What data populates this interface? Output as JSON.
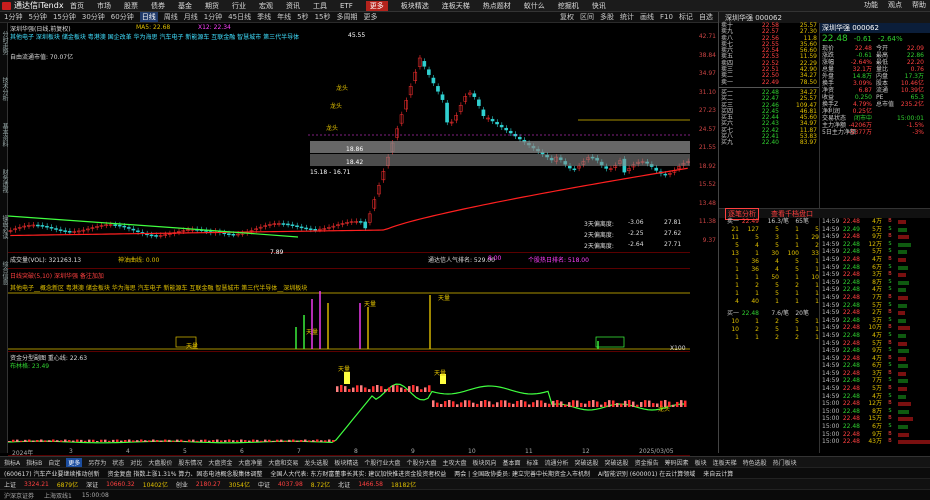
{
  "app": {
    "title": "通达信iTendx"
  },
  "menu": [
    "首页",
    "市场",
    "股票",
    "债券",
    "基金",
    "期货",
    "行业",
    "宏观",
    "资讯",
    "工具",
    "ETF",
    "更多"
  ],
  "menu_right": [
    "板块精选",
    "连板天梯",
    "热点题材",
    "蚁什么",
    "挖掘机",
    "快讯"
  ],
  "window_controls": [
    "功能",
    "观点",
    "帮助"
  ],
  "toolbar": [
    "1分钟",
    "5分钟",
    "15分钟",
    "30分钟",
    "60分钟",
    "日线",
    "周线",
    "月线",
    "1分钟",
    "45日线",
    "季线",
    "年线",
    "5秒",
    "15秒",
    "多周期",
    "更多"
  ],
  "toolbar_right": [
    "复权",
    "区间",
    "多股",
    "统计",
    "画线",
    "F10",
    "标记",
    "自选"
  ],
  "left_tabs": [
    "分时走势",
    "技术分析",
    "基本资料",
    "财务透视",
    "操盘必读",
    "综合信息"
  ],
  "main": {
    "title": "深圳华强(日线,前复权)",
    "ma": "MA5: 22.68",
    "info2": "X12: 22.34",
    "sectors": "其他电子 深圳板块 储金板块 粤港澳 国企改革 华为海思 汽车电子 新能源车 互联金融 智慧城市 第三代半导体",
    "float_cap": "自由流通市值: 70.07亿",
    "price_labels": {
      "high": "45.55",
      "low": "7.89",
      "p1": "18.86",
      "p2": "18.42",
      "p3": "15.18 - 16.71"
    },
    "annotations": [
      "龙头",
      "龙头",
      "龙头",
      "龙头",
      "龙头"
    ],
    "stats": [
      {
        "label": "3天偏离度:",
        "v1": "-3.06",
        "v2": "27.81"
      },
      {
        "label": "2天偏离度:",
        "v1": "-2.25",
        "v2": "27.62"
      },
      {
        "label": "2天偏离度:",
        "v1": "-2.64",
        "v2": "27.71"
      }
    ],
    "y_axis": [
      "42.71",
      "38.84",
      "34.97",
      "31.10",
      "27.23",
      "24.57",
      "21.55",
      "18.92",
      "15.52",
      "13.48",
      "11.38",
      "9.37"
    ]
  },
  "vol": {
    "title": "成交量(VOL): 321263.13",
    "ma": "神油曲线: 0.00",
    "text3": "通达信人气排名: 529.00",
    "text4": "8.00",
    "text5": "个股热日排名: 518.00"
  },
  "sig": {
    "title": "日线突破(5,10)  深圳华强 备注加加",
    "line2": "其他电子__概念新区 粤港澳 储金板块 华为海思 汽车电子 新能源车 互联金融 智慧城市 第三代半导体__深圳板块",
    "tags": [
      "天量",
      "天量",
      "天量",
      "天量",
      "天量",
      "天量"
    ],
    "axis": [
      "X100"
    ]
  },
  "ind": {
    "title": "资金分型副图  重心线: 22.63",
    "sub": "布林格: 23.49",
    "labels": [
      "天量",
      "天量",
      "龙头"
    ],
    "dates": [
      "2024年",
      "3",
      "4",
      "5",
      "6",
      "7",
      "8",
      "9",
      "10",
      "11",
      "12",
      "2025/03/05"
    ]
  },
  "right": {
    "header": "深圳华强 000062",
    "price": "22.48",
    "chg": "-0.61",
    "pct": "-2.64%",
    "sell": [
      {
        "label": "卖十",
        "price": "22.58",
        "vol": "25.57"
      },
      {
        "label": "卖九",
        "price": "22.57",
        "vol": "27.30"
      },
      {
        "label": "卖八",
        "price": "22.56",
        "vol": "11.8"
      },
      {
        "label": "卖七",
        "price": "22.55",
        "vol": "35.60"
      },
      {
        "label": "卖六",
        "price": "22.54",
        "vol": "56.60"
      },
      {
        "label": "卖五",
        "price": "22.53",
        "vol": "11.59"
      },
      {
        "label": "卖四",
        "price": "22.52",
        "vol": "22.29"
      },
      {
        "label": "卖三",
        "price": "22.51",
        "vol": "42.90"
      },
      {
        "label": "卖二",
        "price": "22.50",
        "vol": "34.27"
      },
      {
        "label": "卖一",
        "price": "22.49",
        "vol": "78.50"
      }
    ],
    "buy": [
      {
        "label": "买一",
        "price": "22.48",
        "vol": "34.27"
      },
      {
        "label": "买二",
        "price": "22.47",
        "vol": "25.57"
      },
      {
        "label": "买三",
        "price": "22.46",
        "vol": "109.47"
      },
      {
        "label": "买四",
        "price": "22.45",
        "vol": "46.81"
      },
      {
        "label": "买五",
        "price": "22.44",
        "vol": "45.60"
      },
      {
        "label": "买六",
        "price": "22.43",
        "vol": "34.97"
      },
      {
        "label": "买七",
        "price": "22.42",
        "vol": "11.87"
      },
      {
        "label": "买八",
        "price": "22.41",
        "vol": "53.83"
      },
      {
        "label": "买九",
        "price": "22.40",
        "vol": "83.97"
      }
    ],
    "info": [
      {
        "k": "现价",
        "v": "22.48",
        "k2": "今开",
        "v2": "22.09"
      },
      {
        "k": "涨跌",
        "v": "-0.61",
        "k2": "最高",
        "v2": "22.86"
      },
      {
        "k": "涨幅",
        "v": "-2.64%",
        "k2": "最低",
        "v2": "22.20"
      },
      {
        "k": "总量",
        "v": "32.1万",
        "k2": "量比",
        "v2": "0.76"
      },
      {
        "k": "外盘",
        "v": "14.8万",
        "k2": "内盘",
        "v2": "17.3万"
      },
      {
        "k": "换手",
        "v": "3.09%",
        "k2": "股本",
        "v2": "10.46亿"
      },
      {
        "k": "净资",
        "v": "6.87",
        "k2": "流通",
        "v2": "10.39亿"
      },
      {
        "k": "收益",
        "v": "0.250",
        "k2": "PE",
        "v2": "65.3"
      },
      {
        "k": "换手Z",
        "v": "4.79%",
        "k2": "总市值",
        "v2": "235.2亿"
      },
      {
        "k": "净利润",
        "v": "0.25亿",
        "k2": "",
        "v2": ""
      },
      {
        "k": "交易状态",
        "v": "闭市中",
        "k2": "",
        "v2": "15:00:01"
      },
      {
        "k": "主力净额",
        "v": "-4206万",
        "k2": "",
        "v2": "-1.5%"
      },
      {
        "k": "5日主力净额",
        "v": "-5377万",
        "k2": "",
        "v2": "-3%"
      }
    ],
    "tabs": [
      "逐笔分析",
      "查看千档盘口"
    ],
    "depth_header": {
      "a": "卖一",
      "b": "22.49",
      "c": "16.3/笔",
      "d": "65笔"
    },
    "depth": [
      [
        "21",
        "127",
        "5",
        "1",
        "5"
      ],
      [
        "11",
        "5",
        "3",
        "1",
        "29"
      ],
      [
        "5",
        "4",
        "5",
        "1",
        "2"
      ],
      [
        "13",
        "1",
        "30",
        "100",
        "33"
      ],
      [
        "1",
        "36",
        "4",
        "5",
        "1"
      ],
      [
        "1",
        "36",
        "4",
        "5",
        "1"
      ],
      [
        "1",
        "1",
        "50",
        "1",
        "10"
      ],
      [
        "1",
        "2",
        "5",
        "2",
        "1"
      ],
      [
        "1",
        "1",
        "5",
        "1",
        "1"
      ],
      [
        "4",
        "40",
        "1",
        "1",
        "1"
      ]
    ],
    "depth_footer": {
      "a": "买一",
      "b": "22.48",
      "c": "7.6/笔",
      "d": "20笔"
    },
    "depth2": [
      [
        "10",
        "1",
        "2",
        "5",
        "1"
      ],
      [
        "10",
        "2",
        "5",
        "1",
        "1"
      ],
      [
        "1",
        "1",
        "2",
        "2",
        "1"
      ]
    ],
    "ticks": [
      {
        "t": "14:59",
        "p": "22.48",
        "v": "4万",
        "b": "B"
      },
      {
        "t": "14:59",
        "p": "22.49",
        "v": "5万",
        "b": "S"
      },
      {
        "t": "14:59",
        "p": "22.48",
        "v": "9万",
        "b": "B"
      },
      {
        "t": "14:59",
        "p": "22.48",
        "v": "12万",
        "b": "S"
      },
      {
        "t": "14:59",
        "p": "22.48",
        "v": "5万",
        "b": "S"
      },
      {
        "t": "14:59",
        "p": "22.48",
        "v": "4万",
        "b": "B"
      },
      {
        "t": "14:59",
        "p": "22.48",
        "v": "6万",
        "b": "S"
      },
      {
        "t": "14:59",
        "p": "22.48",
        "v": "3万",
        "b": "B"
      },
      {
        "t": "14:59",
        "p": "22.48",
        "v": "8万",
        "b": "S"
      },
      {
        "t": "14:59",
        "p": "22.48",
        "v": "4万",
        "b": "S"
      },
      {
        "t": "14:59",
        "p": "22.48",
        "v": "7万",
        "b": "B"
      },
      {
        "t": "14:59",
        "p": "22.48",
        "v": "5万",
        "b": "S"
      },
      {
        "t": "14:59",
        "p": "22.48",
        "v": "2万",
        "b": "B"
      },
      {
        "t": "14:59",
        "p": "22.48",
        "v": "3万",
        "b": "S"
      },
      {
        "t": "14:59",
        "p": "22.48",
        "v": "10万",
        "b": "B"
      },
      {
        "t": "14:59",
        "p": "22.48",
        "v": "4万",
        "b": "S"
      },
      {
        "t": "14:59",
        "p": "22.48",
        "v": "5万",
        "b": "B"
      },
      {
        "t": "14:59",
        "p": "22.48",
        "v": "9万",
        "b": "S"
      },
      {
        "t": "14:59",
        "p": "22.48",
        "v": "4万",
        "b": "B"
      },
      {
        "t": "14:59",
        "p": "22.48",
        "v": "6万",
        "b": "S"
      },
      {
        "t": "14:59",
        "p": "22.48",
        "v": "3万",
        "b": "B"
      },
      {
        "t": "14:59",
        "p": "22.48",
        "v": "7万",
        "b": "S"
      },
      {
        "t": "14:59",
        "p": "22.48",
        "v": "5万",
        "b": "B"
      },
      {
        "t": "14:59",
        "p": "22.48",
        "v": "4万",
        "b": "S"
      },
      {
        "t": "15:00",
        "p": "22.48",
        "v": "12万",
        "b": "B"
      },
      {
        "t": "15:00",
        "p": "22.48",
        "v": "8万",
        "b": "S"
      },
      {
        "t": "15:00",
        "p": "22.48",
        "v": "15万",
        "b": "B"
      },
      {
        "t": "15:00",
        "p": "22.48",
        "v": "6万",
        "b": "S"
      },
      {
        "t": "15:00",
        "p": "22.48",
        "v": "9万",
        "b": "B"
      },
      {
        "t": "15:00",
        "p": "22.48",
        "v": "43万",
        "b": "B"
      }
    ]
  },
  "bottom_tabs": [
    "指标A",
    "指标B",
    "自定",
    "更多",
    "另存为",
    "状态",
    "对比",
    "大盘股价",
    "股东情况",
    "大盘资金",
    "大盘净量",
    "大盘和交易",
    "龙头选股",
    "板块精选",
    "个股行业大盘",
    "个股分大盘",
    "主攻大盘",
    "板块风向",
    "基本面",
    "标准",
    "流通分析",
    "突破选股",
    "突破选股",
    "资金报告",
    "筹码因素",
    "板块",
    "连板天梯",
    "特色选股",
    "热门板块"
  ],
  "news": [
    "(600617) 汽车产业要继续推动创新",
    "资金复盘 指数上涨1.31% 算力、固态电池概念股集体调整",
    "全国人大代表: 东方财富董事长其实: 建议加快推进资金投资者权益",
    "两会 | 全国政协委员: 建立完善中长期资金入市机制",
    "AI智能识别 (600001) 在云计算领域",
    "来自云计算"
  ],
  "ticker": [
    {
      "name": "上证",
      "v": "3324.21",
      "c": "6879亿"
    },
    {
      "name": "深证",
      "v": "10660.32",
      "c": "10402亿"
    },
    {
      "name": "创业",
      "v": "2180.27",
      "c": "3054亿"
    },
    {
      "name": "中证",
      "v": "4037.98",
      "c": "8.72亿"
    },
    {
      "name": "北证",
      "v": "1466.58",
      "c": "18182亿"
    }
  ],
  "status": [
    "沪深京证券",
    "上海双线1",
    "15:00:08"
  ]
}
